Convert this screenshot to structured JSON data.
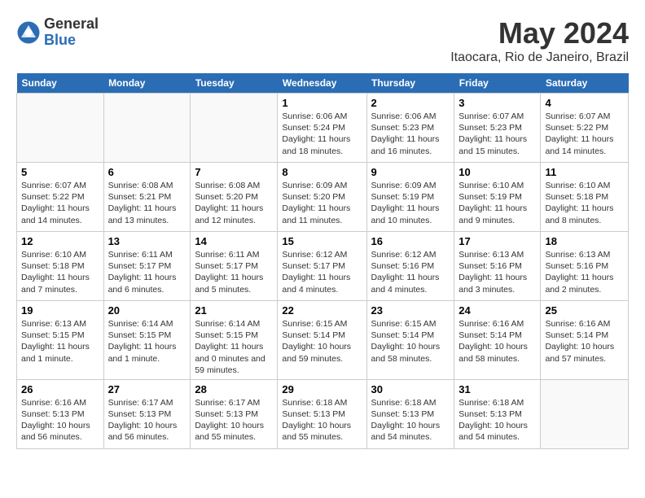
{
  "logo": {
    "general": "General",
    "blue": "Blue"
  },
  "title": "May 2024",
  "subtitle": "Itaocara, Rio de Janeiro, Brazil",
  "days_of_week": [
    "Sunday",
    "Monday",
    "Tuesday",
    "Wednesday",
    "Thursday",
    "Friday",
    "Saturday"
  ],
  "weeks": [
    [
      {
        "num": "",
        "info": ""
      },
      {
        "num": "",
        "info": ""
      },
      {
        "num": "",
        "info": ""
      },
      {
        "num": "1",
        "info": "Sunrise: 6:06 AM\nSunset: 5:24 PM\nDaylight: 11 hours and 18 minutes."
      },
      {
        "num": "2",
        "info": "Sunrise: 6:06 AM\nSunset: 5:23 PM\nDaylight: 11 hours and 16 minutes."
      },
      {
        "num": "3",
        "info": "Sunrise: 6:07 AM\nSunset: 5:23 PM\nDaylight: 11 hours and 15 minutes."
      },
      {
        "num": "4",
        "info": "Sunrise: 6:07 AM\nSunset: 5:22 PM\nDaylight: 11 hours and 14 minutes."
      }
    ],
    [
      {
        "num": "5",
        "info": "Sunrise: 6:07 AM\nSunset: 5:22 PM\nDaylight: 11 hours and 14 minutes."
      },
      {
        "num": "6",
        "info": "Sunrise: 6:08 AM\nSunset: 5:21 PM\nDaylight: 11 hours and 13 minutes."
      },
      {
        "num": "7",
        "info": "Sunrise: 6:08 AM\nSunset: 5:20 PM\nDaylight: 11 hours and 12 minutes."
      },
      {
        "num": "8",
        "info": "Sunrise: 6:09 AM\nSunset: 5:20 PM\nDaylight: 11 hours and 11 minutes."
      },
      {
        "num": "9",
        "info": "Sunrise: 6:09 AM\nSunset: 5:19 PM\nDaylight: 11 hours and 10 minutes."
      },
      {
        "num": "10",
        "info": "Sunrise: 6:10 AM\nSunset: 5:19 PM\nDaylight: 11 hours and 9 minutes."
      },
      {
        "num": "11",
        "info": "Sunrise: 6:10 AM\nSunset: 5:18 PM\nDaylight: 11 hours and 8 minutes."
      }
    ],
    [
      {
        "num": "12",
        "info": "Sunrise: 6:10 AM\nSunset: 5:18 PM\nDaylight: 11 hours and 7 minutes."
      },
      {
        "num": "13",
        "info": "Sunrise: 6:11 AM\nSunset: 5:17 PM\nDaylight: 11 hours and 6 minutes."
      },
      {
        "num": "14",
        "info": "Sunrise: 6:11 AM\nSunset: 5:17 PM\nDaylight: 11 hours and 5 minutes."
      },
      {
        "num": "15",
        "info": "Sunrise: 6:12 AM\nSunset: 5:17 PM\nDaylight: 11 hours and 4 minutes."
      },
      {
        "num": "16",
        "info": "Sunrise: 6:12 AM\nSunset: 5:16 PM\nDaylight: 11 hours and 4 minutes."
      },
      {
        "num": "17",
        "info": "Sunrise: 6:13 AM\nSunset: 5:16 PM\nDaylight: 11 hours and 3 minutes."
      },
      {
        "num": "18",
        "info": "Sunrise: 6:13 AM\nSunset: 5:16 PM\nDaylight: 11 hours and 2 minutes."
      }
    ],
    [
      {
        "num": "19",
        "info": "Sunrise: 6:13 AM\nSunset: 5:15 PM\nDaylight: 11 hours and 1 minute."
      },
      {
        "num": "20",
        "info": "Sunrise: 6:14 AM\nSunset: 5:15 PM\nDaylight: 11 hours and 1 minute."
      },
      {
        "num": "21",
        "info": "Sunrise: 6:14 AM\nSunset: 5:15 PM\nDaylight: 11 hours and 0 minutes and 59 minutes."
      },
      {
        "num": "22",
        "info": "Sunrise: 6:15 AM\nSunset: 5:14 PM\nDaylight: 10 hours and 59 minutes."
      },
      {
        "num": "23",
        "info": "Sunrise: 6:15 AM\nSunset: 5:14 PM\nDaylight: 10 hours and 58 minutes."
      },
      {
        "num": "24",
        "info": "Sunrise: 6:16 AM\nSunset: 5:14 PM\nDaylight: 10 hours and 58 minutes."
      },
      {
        "num": "25",
        "info": "Sunrise: 6:16 AM\nSunset: 5:14 PM\nDaylight: 10 hours and 57 minutes."
      }
    ],
    [
      {
        "num": "26",
        "info": "Sunrise: 6:16 AM\nSunset: 5:13 PM\nDaylight: 10 hours and 56 minutes."
      },
      {
        "num": "27",
        "info": "Sunrise: 6:17 AM\nSunset: 5:13 PM\nDaylight: 10 hours and 56 minutes."
      },
      {
        "num": "28",
        "info": "Sunrise: 6:17 AM\nSunset: 5:13 PM\nDaylight: 10 hours and 55 minutes."
      },
      {
        "num": "29",
        "info": "Sunrise: 6:18 AM\nSunset: 5:13 PM\nDaylight: 10 hours and 55 minutes."
      },
      {
        "num": "30",
        "info": "Sunrise: 6:18 AM\nSunset: 5:13 PM\nDaylight: 10 hours and 54 minutes."
      },
      {
        "num": "31",
        "info": "Sunrise: 6:18 AM\nSunset: 5:13 PM\nDaylight: 10 hours and 54 minutes."
      },
      {
        "num": "",
        "info": ""
      }
    ]
  ]
}
